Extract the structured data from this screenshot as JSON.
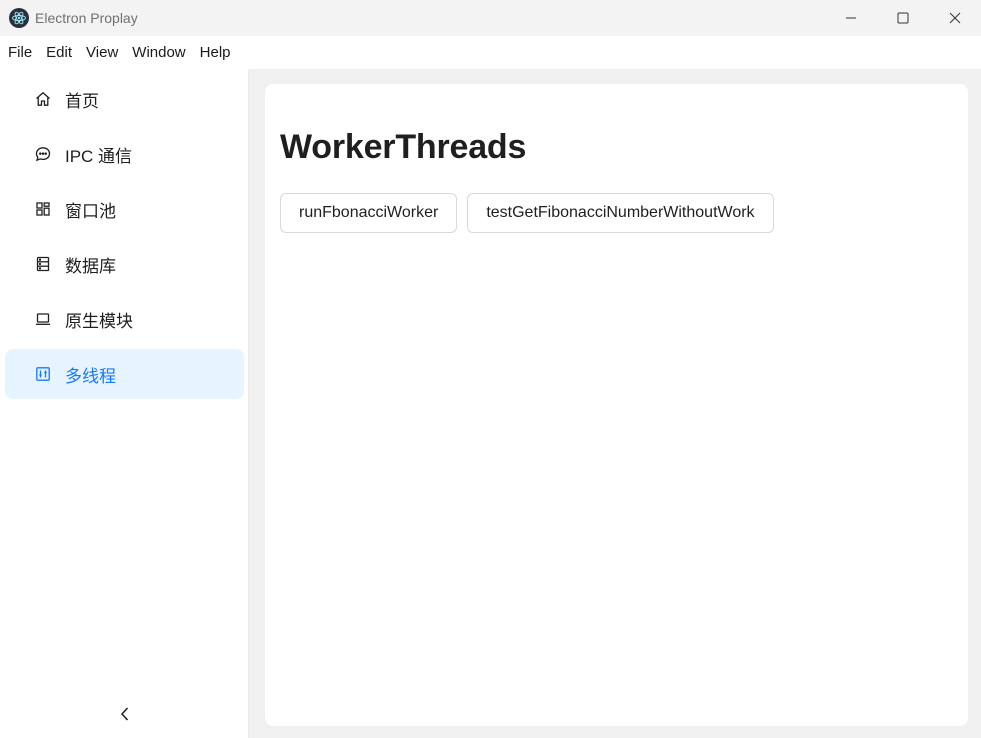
{
  "window": {
    "title": "Electron Proplay",
    "logo_icon": "electron-icon",
    "controls": [
      "minimize-icon",
      "maximize-icon",
      "close-icon"
    ]
  },
  "menubar": {
    "items": [
      "File",
      "Edit",
      "View",
      "Window",
      "Help"
    ]
  },
  "sidebar": {
    "items": [
      {
        "label": "首页",
        "icon": "home-icon",
        "active": false
      },
      {
        "label": "IPC 通信",
        "icon": "chat-icon",
        "active": false
      },
      {
        "label": "窗口池",
        "icon": "app-grid-icon",
        "active": false
      },
      {
        "label": "数据库",
        "icon": "database-icon",
        "active": false
      },
      {
        "label": "原生模块",
        "icon": "laptop-icon",
        "active": false
      },
      {
        "label": "多线程",
        "icon": "sliders-icon",
        "active": true
      }
    ],
    "collapse_icon": "chevron-left-icon"
  },
  "main": {
    "title": "WorkerThreads",
    "buttons": [
      {
        "label": "runFbonacciWorker"
      },
      {
        "label": "testGetFibonacciNumberWithoutWork"
      }
    ]
  },
  "colors": {
    "accent": "#1677ff",
    "active_bg": "#e6f4ff",
    "app_bg": "#f0f0f0"
  }
}
